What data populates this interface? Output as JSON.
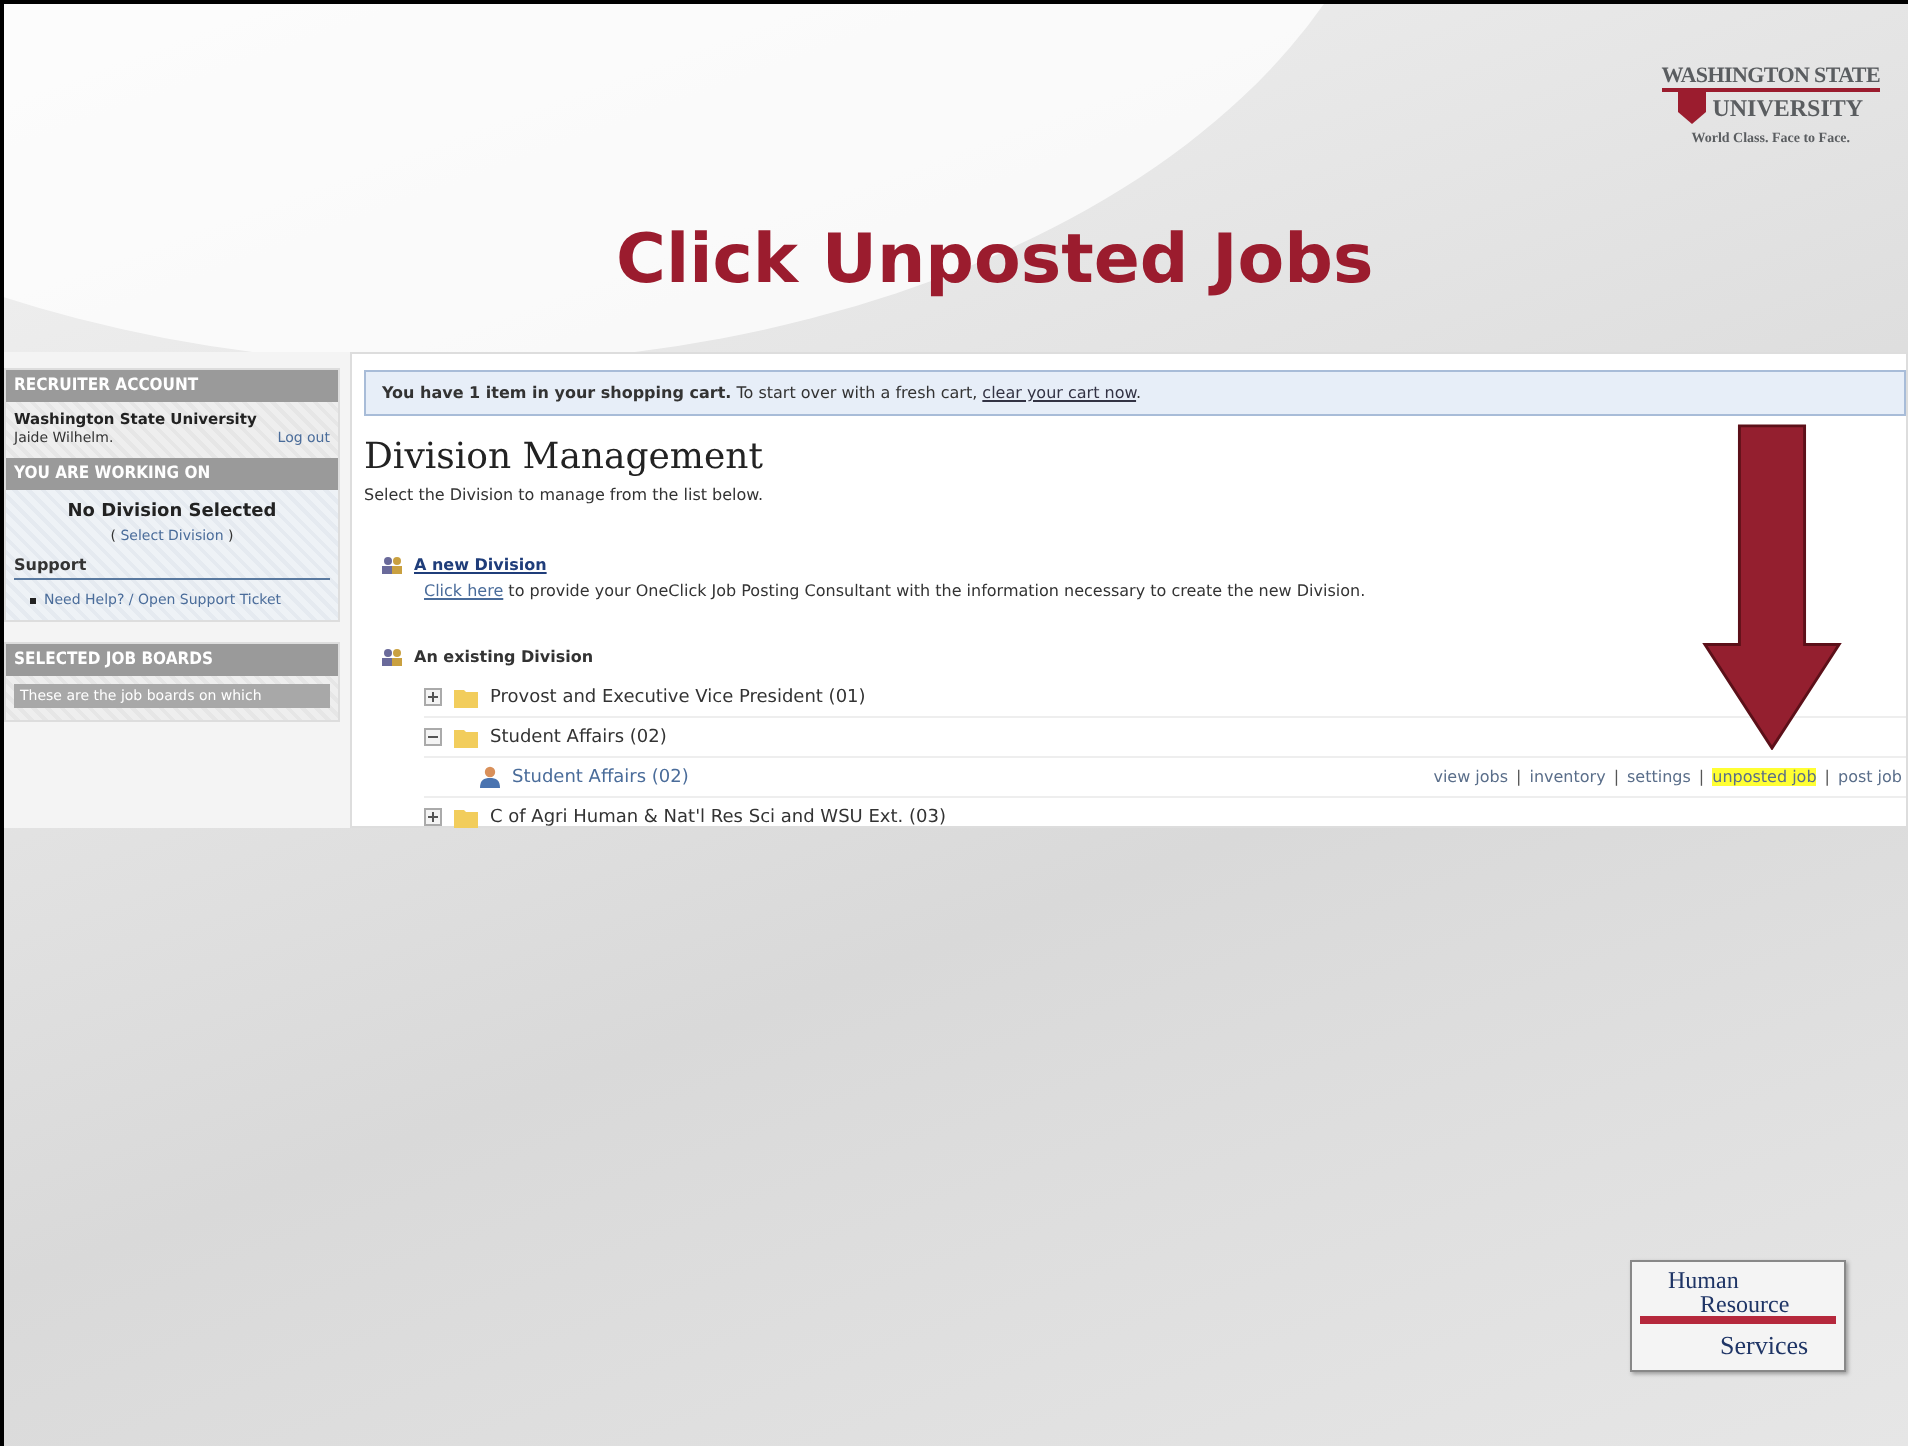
{
  "slide": {
    "title": "Click Unposted Jobs",
    "logo_top": {
      "line_1": "WASHINGTON STATE",
      "line_2": "UNIVERSITY",
      "tagline": "World Class. Face to Face."
    },
    "logo_bottom": {
      "line_1": "Human",
      "line_2": "Resource",
      "line_3": "Services"
    }
  },
  "sidebar": {
    "sections": [
      {
        "heading": "RECRUITER ACCOUNT",
        "kind": "account",
        "org": "Washington State University",
        "user": "Jaide Wilhelm.",
        "logout": "Log out"
      },
      {
        "heading": "YOU ARE WORKING ON",
        "kind": "working",
        "status": "No Division Selected",
        "open": "(",
        "link": "Select Division",
        "close": ")",
        "support_heading": "Support",
        "support_link": "Need Help? / Open Support Ticket"
      },
      {
        "heading": "SELECTED JOB BOARDS",
        "kind": "boards",
        "note": "These are the job boards on which"
      }
    ]
  },
  "main": {
    "cart": {
      "bold": "You have 1 item in your shopping cart.",
      "text": "To start over with a fresh cart,",
      "link": "clear your cart now",
      "end": "."
    },
    "title": "Division Management",
    "intro": "Select the Division to manage from the list below.",
    "new_division": {
      "link": "A new Division",
      "click": "Click here",
      "text": "to provide your OneClick Job Posting Consultant with the information necessary to create the new Division."
    },
    "existing": "An existing Division",
    "tree": [
      {
        "label": "Provost and Executive Vice President (01)",
        "expanded": false
      },
      {
        "label": "Student Affairs (02)",
        "expanded": true,
        "children": [
          {
            "label": "Student Affairs (02)",
            "separator": "|",
            "actions": [
              {
                "label": "view jobs",
                "highlighted": false
              },
              {
                "label": "inventory",
                "highlighted": false
              },
              {
                "label": "settings",
                "highlighted": false
              },
              {
                "label": "unposted job",
                "highlighted": true
              },
              {
                "label": "post job",
                "highlighted": false
              }
            ]
          }
        ]
      },
      {
        "label": "C of Agri Human & Nat'l Res Sci and WSU Ext. (03)",
        "expanded": false
      }
    ]
  }
}
